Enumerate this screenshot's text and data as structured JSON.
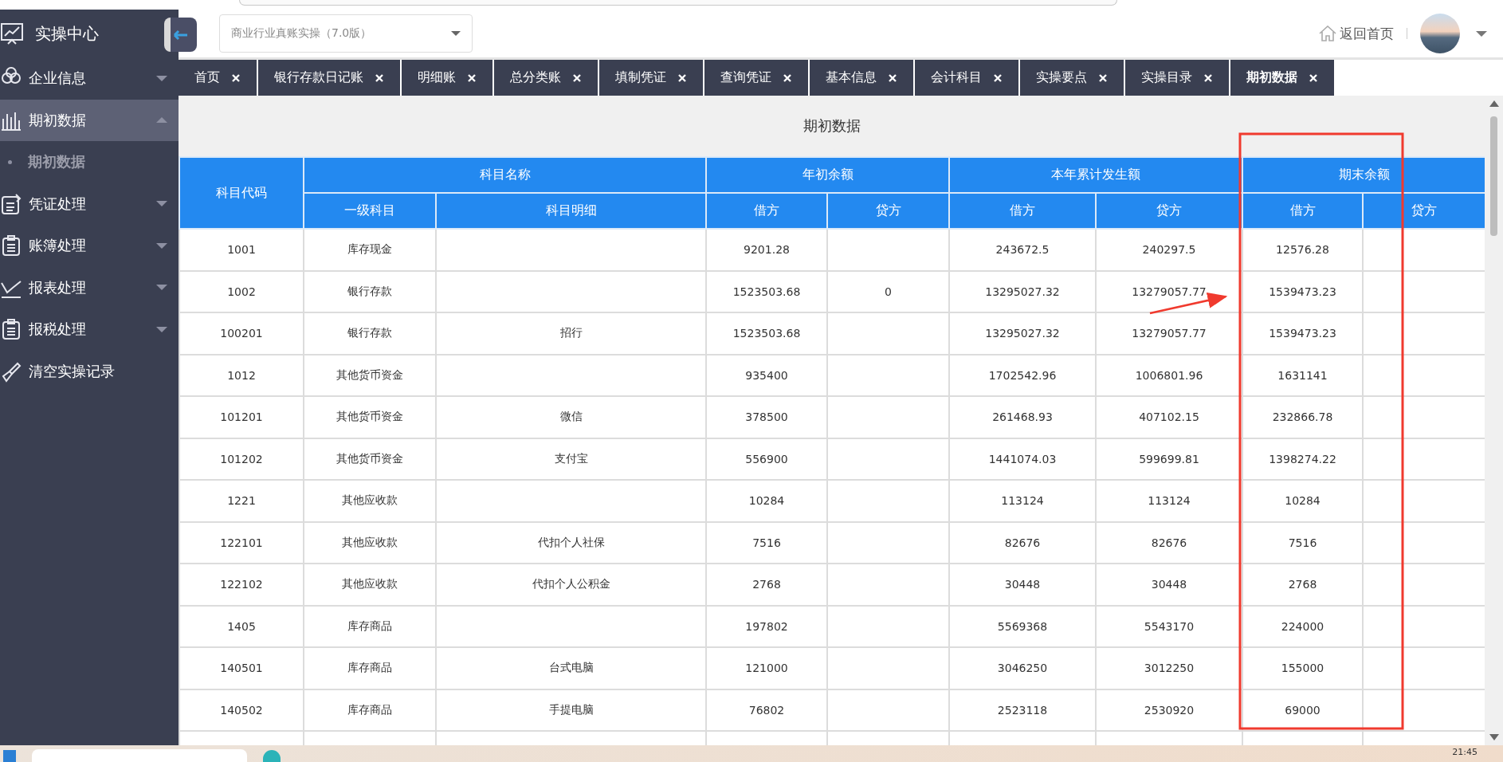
{
  "sidebar": {
    "title": "实操中心",
    "items": [
      {
        "label": "企业信息",
        "kind": "menu",
        "expanded": false,
        "selected": false
      },
      {
        "label": "期初数据",
        "kind": "menu",
        "expanded": true,
        "selected": true,
        "children": [
          {
            "label": "期初数据",
            "selected": true
          }
        ]
      },
      {
        "label": "凭证处理",
        "kind": "menu",
        "expanded": false,
        "selected": false
      },
      {
        "label": "账簿处理",
        "kind": "menu",
        "expanded": false,
        "selected": false
      },
      {
        "label": "报表处理",
        "kind": "menu",
        "expanded": false,
        "selected": false
      },
      {
        "label": "报税处理",
        "kind": "menu",
        "expanded": false,
        "selected": false
      },
      {
        "label": "清空实操记录",
        "kind": "action",
        "selected": false
      }
    ]
  },
  "header": {
    "course_select": {
      "value": "商业行业真账实操（7.0版）"
    },
    "home_link": "返回首页"
  },
  "tabs": [
    {
      "label": "首页",
      "selected": false
    },
    {
      "label": "银行存款日记账",
      "selected": false
    },
    {
      "label": "明细账",
      "selected": false
    },
    {
      "label": "总分类账",
      "selected": false
    },
    {
      "label": "填制凭证",
      "selected": false
    },
    {
      "label": "查询凭证",
      "selected": false
    },
    {
      "label": "基本信息",
      "selected": false
    },
    {
      "label": "会计科目",
      "selected": false
    },
    {
      "label": "实操要点",
      "selected": false
    },
    {
      "label": "实操目录",
      "selected": false
    },
    {
      "label": "期初数据",
      "selected": true
    }
  ],
  "page_title": "期初数据",
  "table": {
    "column_groups": [
      {
        "label": "科目代码"
      },
      {
        "label": "科目名称",
        "columns": [
          "一级科目",
          "科目明细"
        ]
      },
      {
        "label": "年初余额",
        "columns": [
          "借方",
          "贷方"
        ]
      },
      {
        "label": "本年累计发生额",
        "columns": [
          "借方",
          "贷方"
        ]
      },
      {
        "label": "期末余额",
        "columns": [
          "借方",
          "贷方"
        ]
      }
    ],
    "rows": [
      {
        "code": "1001",
        "account": "库存现金",
        "opening_debit": "9201.28",
        "ytd_debit": "243672.5",
        "ytd_credit": "240297.5",
        "closing_debit": "12576.28"
      },
      {
        "code": "1002",
        "account": "银行存款",
        "opening_debit": "1523503.68",
        "opening_credit": "0",
        "ytd_debit": "13295027.32",
        "ytd_credit": "13279057.77",
        "closing_debit": "1539473.23"
      },
      {
        "code": "100201",
        "account": "银行存款",
        "detail": "招行",
        "opening_debit": "1523503.68",
        "ytd_debit": "13295027.32",
        "ytd_credit": "13279057.77",
        "closing_debit": "1539473.23"
      },
      {
        "code": "1012",
        "account": "其他货币资金",
        "opening_debit": "935400",
        "ytd_debit": "1702542.96",
        "ytd_credit": "1006801.96",
        "closing_debit": "1631141"
      },
      {
        "code": "101201",
        "account": "其他货币资金",
        "detail": "微信",
        "opening_debit": "378500",
        "ytd_debit": "261468.93",
        "ytd_credit": "407102.15",
        "closing_debit": "232866.78"
      },
      {
        "code": "101202",
        "account": "其他货币资金",
        "detail": "支付宝",
        "opening_debit": "556900",
        "ytd_debit": "1441074.03",
        "ytd_credit": "599699.81",
        "closing_debit": "1398274.22"
      },
      {
        "code": "1221",
        "account": "其他应收款",
        "opening_debit": "10284",
        "ytd_debit": "113124",
        "ytd_credit": "113124",
        "closing_debit": "10284"
      },
      {
        "code": "122101",
        "account": "其他应收款",
        "detail": "代扣个人社保",
        "opening_debit": "7516",
        "ytd_debit": "82676",
        "ytd_credit": "82676",
        "closing_debit": "7516"
      },
      {
        "code": "122102",
        "account": "其他应收款",
        "detail": "代扣个人公积金",
        "opening_debit": "2768",
        "ytd_debit": "30448",
        "ytd_credit": "30448",
        "closing_debit": "2768"
      },
      {
        "code": "1405",
        "account": "库存商品",
        "opening_debit": "197802",
        "ytd_debit": "5569368",
        "ytd_credit": "5543170",
        "closing_debit": "224000"
      },
      {
        "code": "140501",
        "account": "库存商品",
        "detail": "台式电脑",
        "opening_debit": "121000",
        "ytd_debit": "3046250",
        "ytd_credit": "3012250",
        "closing_debit": "155000"
      },
      {
        "code": "140502",
        "account": "库存商品",
        "detail": "手提电脑",
        "opening_debit": "76802",
        "ytd_debit": "2523118",
        "ytd_credit": "2530920",
        "closing_debit": "69000"
      }
    ]
  },
  "taskbar": {
    "clock": "21:45"
  }
}
